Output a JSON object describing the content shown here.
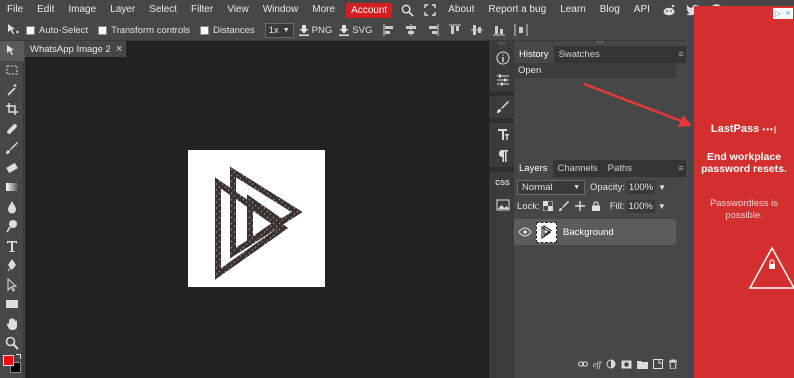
{
  "menu": {
    "items": [
      "File",
      "Edit",
      "Image",
      "Layer",
      "Select",
      "Filter",
      "View",
      "Window",
      "More"
    ],
    "account": "Account",
    "right_items": [
      "About",
      "Report a bug",
      "Learn",
      "Blog",
      "API"
    ]
  },
  "options": {
    "auto_select": "Auto-Select",
    "transform_controls": "Transform controls",
    "distances": "Distances",
    "zoom": "1x",
    "png": "PNG",
    "svg": "SVG"
  },
  "document": {
    "tab_title": "WhatsApp Image 2(",
    "tab_title_fade": "0"
  },
  "history_panel": {
    "tabs": [
      "History",
      "Swatches"
    ],
    "entries": [
      "Open"
    ]
  },
  "layers_panel": {
    "tabs": [
      "Layers",
      "Channels",
      "Paths"
    ],
    "blend_mode": "Normal",
    "opacity_label": "Opacity:",
    "opacity_value": "100%",
    "lock_label": "Lock:",
    "fill_label": "Fill:",
    "fill_value": "100%",
    "layers": [
      {
        "name": "Background"
      }
    ]
  },
  "minipanel": {
    "css_label": "CSS"
  },
  "ad": {
    "brand": "LastPass",
    "headline": "End workplace password resets.",
    "subline": "Passwordless is possible."
  },
  "colors": {
    "accent": "#d31f1f",
    "foreground": "#ff0000",
    "background": "#000000",
    "arrow": "#e53935"
  }
}
